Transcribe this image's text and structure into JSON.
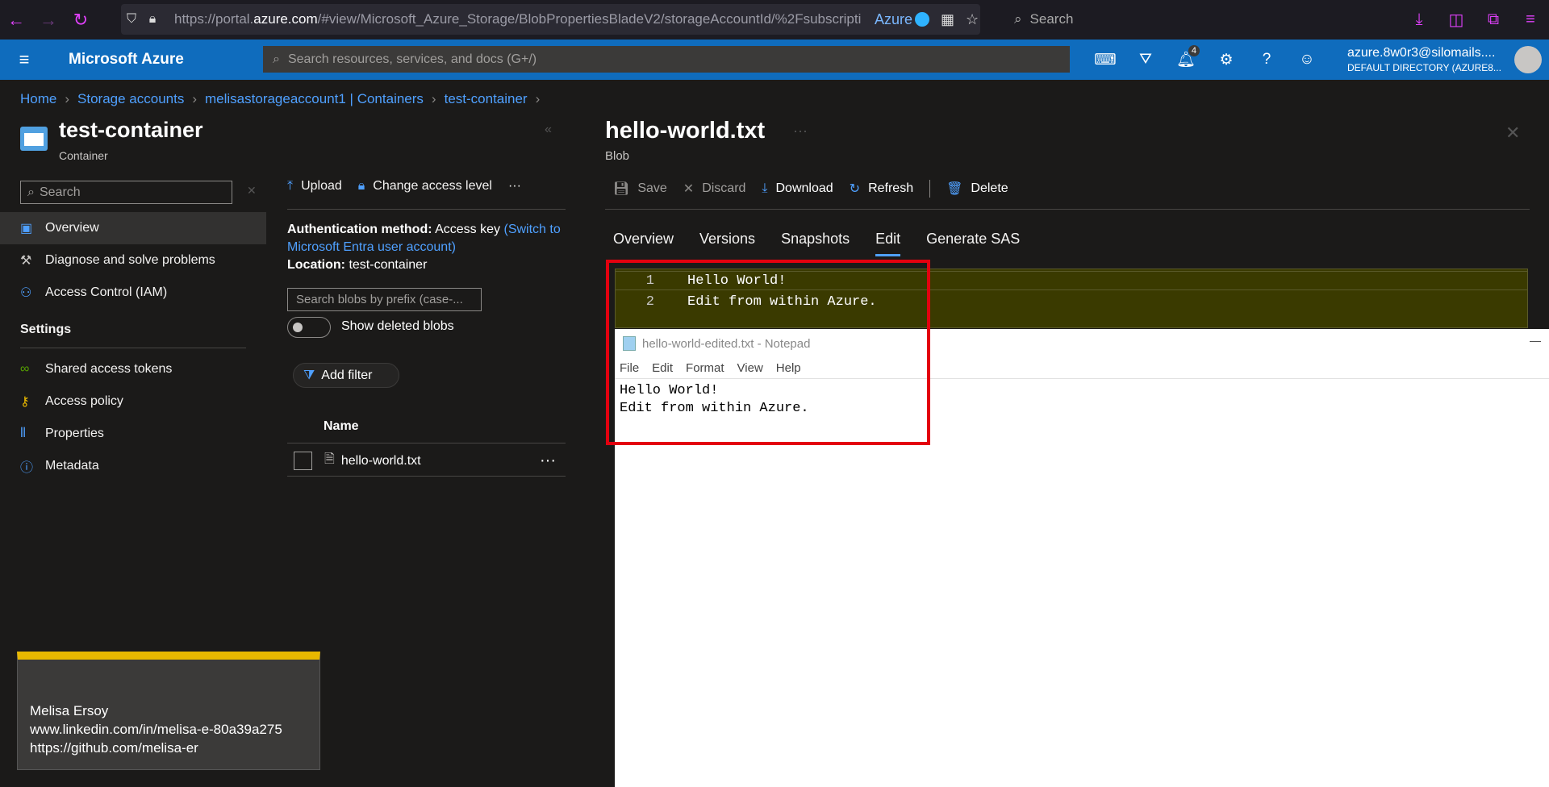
{
  "browser": {
    "url_prefix": "https://portal.",
    "url_domain": "azure.com",
    "url_rest": "/#view/Microsoft_Azure_Storage/BlobPropertiesBladeV2/storageAccountId/%2Fsubscripti",
    "container_tag": "Azure",
    "search_placeholder": "Search"
  },
  "azure": {
    "brand": "Microsoft Azure",
    "search_placeholder": "Search resources, services, and docs (G+/)",
    "notification_count": "4",
    "account_name": "azure.8w0r3@silomails....",
    "directory": "DEFAULT DIRECTORY (AZURE8..."
  },
  "breadcrumb": [
    "Home",
    "Storage accounts",
    "melisastorageaccount1 | Containers",
    "test-container"
  ],
  "container": {
    "title": "test-container",
    "subtitle": "Container",
    "search_placeholder": "Search",
    "menu": {
      "overview": "Overview",
      "diagnose": "Diagnose and solve problems",
      "iam": "Access Control (IAM)",
      "settings_heading": "Settings",
      "sas": "Shared access tokens",
      "policy": "Access policy",
      "properties": "Properties",
      "metadata": "Metadata"
    },
    "toolbar": {
      "upload": "Upload",
      "change_access": "Change access level",
      "more": "···"
    },
    "auth_label": "Authentication method:",
    "auth_value": "Access key",
    "auth_link": "(Switch to Microsoft Entra user account)",
    "location_label": "Location:",
    "location_value": "test-container",
    "blob_search_placeholder": "Search blobs by prefix (case-...",
    "show_deleted": "Show deleted blobs",
    "add_filter": "Add filter",
    "column_name": "Name",
    "rows": [
      {
        "name": "hello-world.txt"
      }
    ]
  },
  "blob": {
    "title": "hello-world.txt",
    "subtitle": "Blob",
    "toolbar": {
      "save": "Save",
      "discard": "Discard",
      "download": "Download",
      "refresh": "Refresh",
      "delete": "Delete"
    },
    "tabs": [
      "Overview",
      "Versions",
      "Snapshots",
      "Edit",
      "Generate SAS"
    ],
    "active_tab": "Edit",
    "editor_lines": [
      {
        "num": "1",
        "text": "Hello World!"
      },
      {
        "num": "2",
        "text": "Edit from within Azure."
      }
    ]
  },
  "notepad": {
    "title": "hello-world-edited.txt - Notepad",
    "menu": [
      "File",
      "Edit",
      "Format",
      "View",
      "Help"
    ],
    "content": "Hello World!\nEdit from within Azure."
  },
  "signature": {
    "name": "Melisa Ersoy",
    "linkedin": "www.linkedin.com/in/melisa-e-80a39a275",
    "github": "https://github.com/melisa-er"
  },
  "colors": {
    "accent": "#0f6cbd",
    "link": "#4fa0ff",
    "highlight": "#e3000f",
    "signature_bar": "#e8b800"
  }
}
